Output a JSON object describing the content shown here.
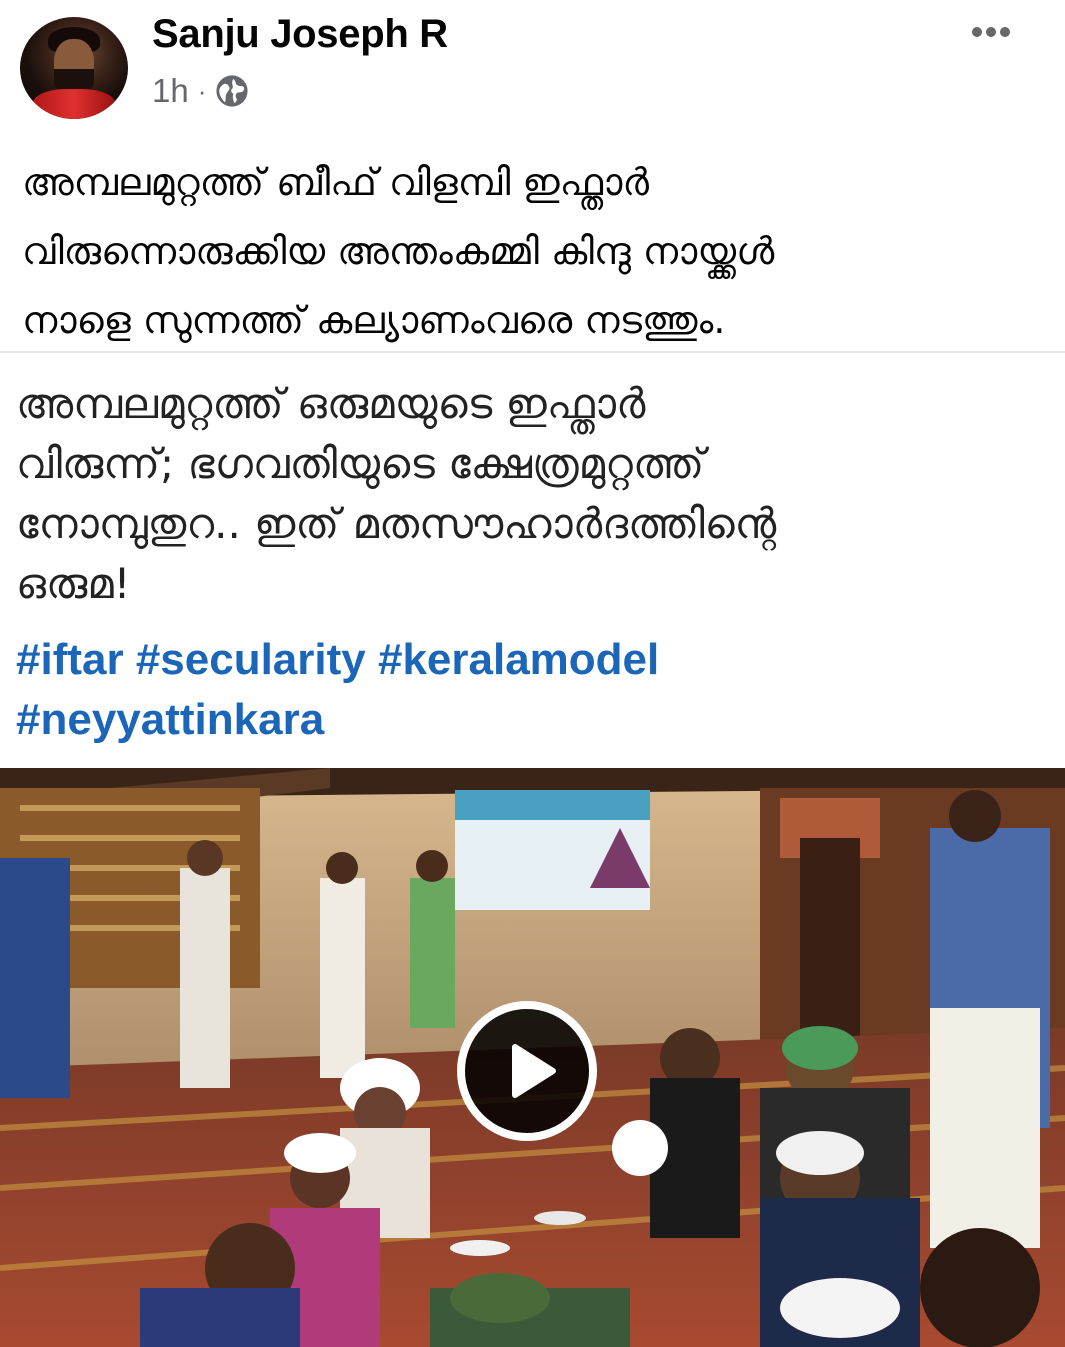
{
  "post": {
    "author": "Sanju Joseph R",
    "time": "1h",
    "separator": "·",
    "privacy_icon": "globe-icon",
    "menu_icon": "more-options-icon",
    "text_lines": [
      "അമ്പലമുറ്റത്ത് ബീഫ് വിളമ്പി  ഇഫ്താർ",
      "വിരുന്നൊരുക്കിയ അന്തംകമ്മി കിന്ദു നായ്ക്കൾ",
      "നാളെ സുന്നത്ത് കല്യാണംവരെ നടത്തും."
    ]
  },
  "shared_image": {
    "caption_lines": [
      "അമ്പലമുറ്റത്ത് ഒരുമയുടെ ഇഫ്താർ",
      "വിരുന്ന്; ഭഗവതിയുടെ ക്ഷേത്രമുറ്റത്ത്",
      "നോമ്പുതുറ.. ഇത് മതസൗഹാർദത്തിന്റെ",
      "ഒരുമ!"
    ],
    "hashtag_lines": [
      "#iftar #secularity #keralamodel",
      "#neyyattinkara"
    ],
    "video_play_icon": "play-icon"
  },
  "colors": {
    "text": "#050505",
    "meta": "#65676b",
    "hashtag": "#1b66b8",
    "divider": "#e4e6eb"
  }
}
